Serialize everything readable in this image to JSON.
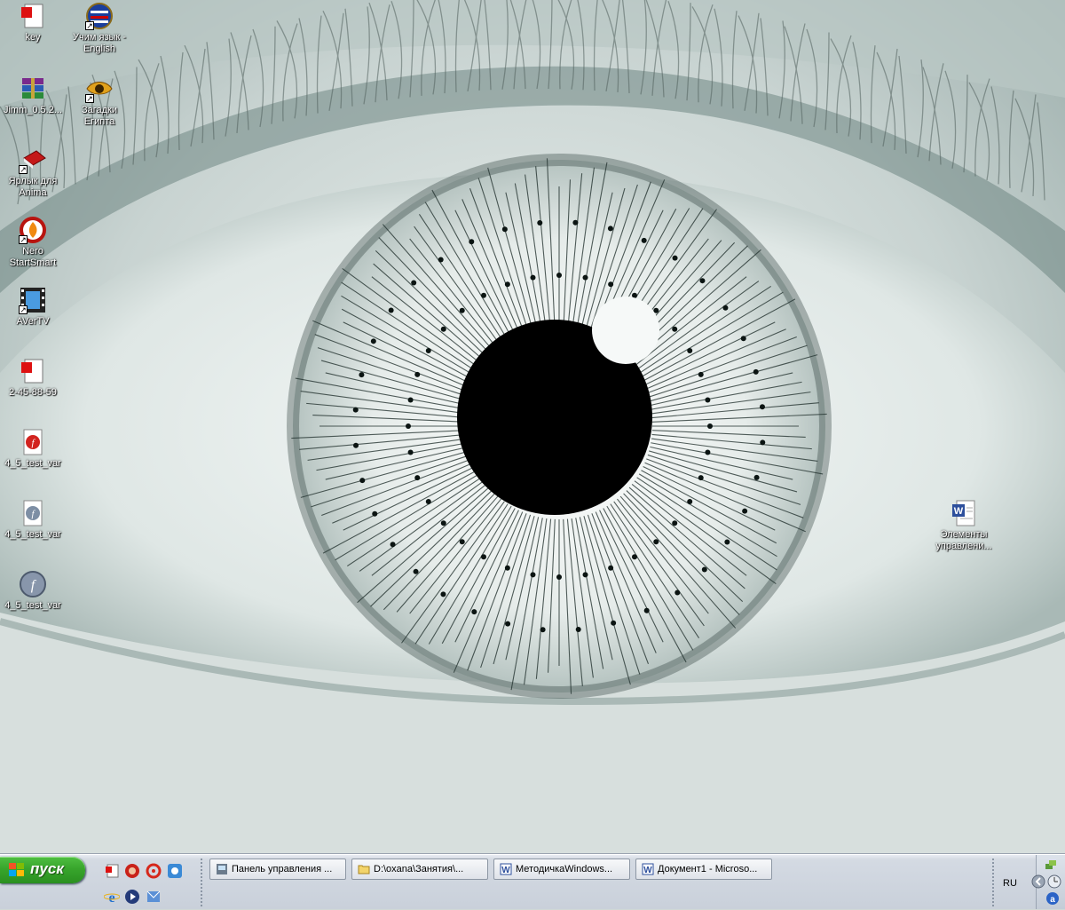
{
  "desktop": {
    "icons": [
      {
        "label": "key",
        "icon": "document-red-icon"
      },
      {
        "label": "Учим язык - English",
        "icon": "us-flag-globe-icon"
      },
      {
        "label": "Jimm_0.5.2...",
        "icon": "winrar-archive-icon"
      },
      {
        "label": "Загадки Египта",
        "icon": "egypt-eye-icon"
      },
      {
        "label": "Ярлык для Anima",
        "icon": "red-book-icon"
      },
      {
        "label": "Nero StartSmart",
        "icon": "nero-flame-icon"
      },
      {
        "label": "AVerTV",
        "icon": "film-tv-icon"
      },
      {
        "label": "2-45-88-59",
        "icon": "document-red-icon"
      },
      {
        "label": "4_5_test_var",
        "icon": "flash-document-icon"
      },
      {
        "label": "4_5_test_var",
        "icon": "flash-movie-document-icon"
      },
      {
        "label": "4_5_test_var",
        "icon": "flash-player-icon"
      },
      {
        "label": "Элементы управлени...",
        "icon": "word-document-icon"
      }
    ]
  },
  "taskbar": {
    "start_label": "пуск",
    "quick_launch": [
      "show-desktop-icon",
      "opera-icon",
      "antivirus-icon",
      "qip-icon",
      "internet-explorer-icon",
      "media-player-icon",
      "outlook-express-icon"
    ],
    "tasks": [
      {
        "label": "Панель управления ...",
        "icon": "control-panel-icon"
      },
      {
        "label": "D:\\oxana\\Занятия\\...",
        "icon": "folder-icon"
      },
      {
        "label": "МетодичкаWindows...",
        "icon": "word-icon"
      },
      {
        "label": "Документ1 - Microso...",
        "icon": "word-icon"
      }
    ],
    "language": "RU",
    "tray": [
      "network-icon",
      "back-arrow-icon",
      "clock-icon",
      "update-icon"
    ]
  },
  "colors": {
    "start_green": "#38a52c",
    "taskbar": "#d4dae3",
    "wallpaper_tint": "#cfd8d6"
  }
}
